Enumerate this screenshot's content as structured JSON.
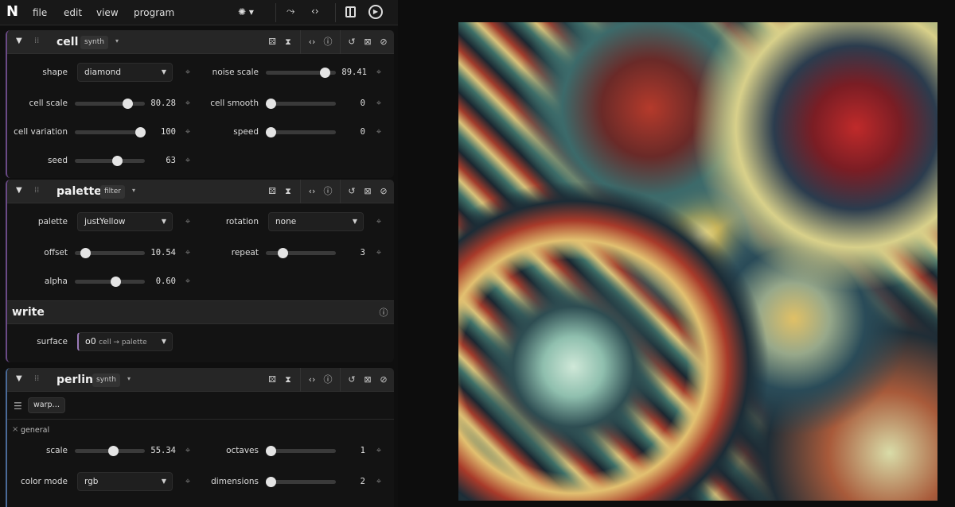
{
  "app": {
    "logo": "N",
    "menu": [
      "file",
      "edit",
      "view",
      "program"
    ]
  },
  "toolbar": {
    "icons": [
      "effect-picker-icon",
      "route-icon",
      "code-icon",
      "split-view-icon",
      "play-cycle-icon"
    ]
  },
  "cell": {
    "title": "cell",
    "tag": "synth",
    "shape": {
      "label": "shape",
      "value": "diamond"
    },
    "noise_scale": {
      "label": "noise scale",
      "value": "89.41",
      "frac": 0.9
    },
    "cell_scale": {
      "label": "cell scale",
      "value": "80.28",
      "frac": 0.75
    },
    "cell_smooth": {
      "label": "cell smooth",
      "value": "0",
      "frac": 0
    },
    "cell_variation": {
      "label": "cell variation",
      "value": "100",
      "frac": 0.93
    },
    "speed": {
      "label": "speed",
      "value": "0",
      "frac": 0
    },
    "seed": {
      "label": "seed",
      "value": "63",
      "frac": 0.6
    }
  },
  "palette": {
    "title": "palette",
    "tag": "filter",
    "palette": {
      "label": "palette",
      "value": "justYellow"
    },
    "rotation": {
      "label": "rotation",
      "value": "none"
    },
    "offset": {
      "label": "offset",
      "value": "10.54",
      "frac": 0.15
    },
    "repeat": {
      "label": "repeat",
      "value": "3",
      "frac": 0.2
    },
    "alpha": {
      "label": "alpha",
      "value": "0.60",
      "frac": 0.58
    }
  },
  "write": {
    "title": "write",
    "surface_label": "surface",
    "surface_value": "o0",
    "surface_chain": "cell → palette"
  },
  "perlin": {
    "title": "perlin",
    "tag": "synth",
    "warp_label": "warp…",
    "section": "general",
    "scale": {
      "label": "scale",
      "value": "55.34",
      "frac": 0.55
    },
    "octaves": {
      "label": "octaves",
      "value": "1",
      "frac": 0
    },
    "color_mode": {
      "label": "color mode",
      "value": "rgb"
    },
    "dimensions": {
      "label": "dimensions",
      "value": "2",
      "frac": 0
    }
  },
  "colors": {
    "accent": "#6a4a86",
    "panel": "#131313",
    "header": "#262626"
  }
}
